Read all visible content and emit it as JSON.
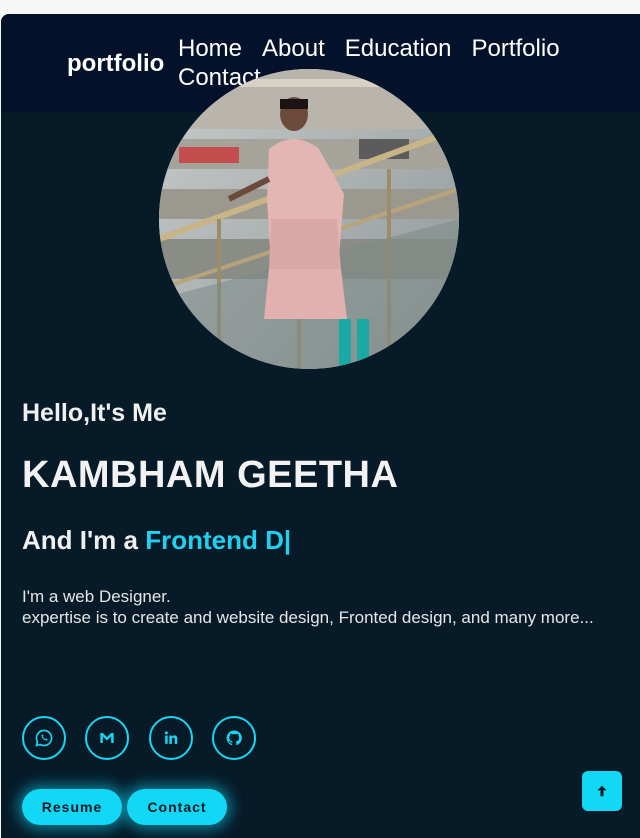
{
  "header": {
    "logo": "portfolio",
    "nav": [
      "Home",
      "About",
      "Education",
      "Portfolio",
      "Contact"
    ]
  },
  "hero": {
    "greeting": "Hello,It's Me",
    "name": "KAMBHAM GEETHA",
    "role_prefix": "And I'm a ",
    "role_typed": "Frontend D|",
    "description_line1": "I'm a web Designer.",
    "description_line2": "expertise is to create and website design, Fronted design, and many more..."
  },
  "socials": [
    "whatsapp-icon",
    "gmail-icon",
    "linkedin-icon",
    "github-icon"
  ],
  "buttons": {
    "resume": "Resume",
    "contact": "Contact"
  },
  "colors": {
    "accent": "#12d7f5",
    "background": "#061a28",
    "header": "#03122a"
  }
}
